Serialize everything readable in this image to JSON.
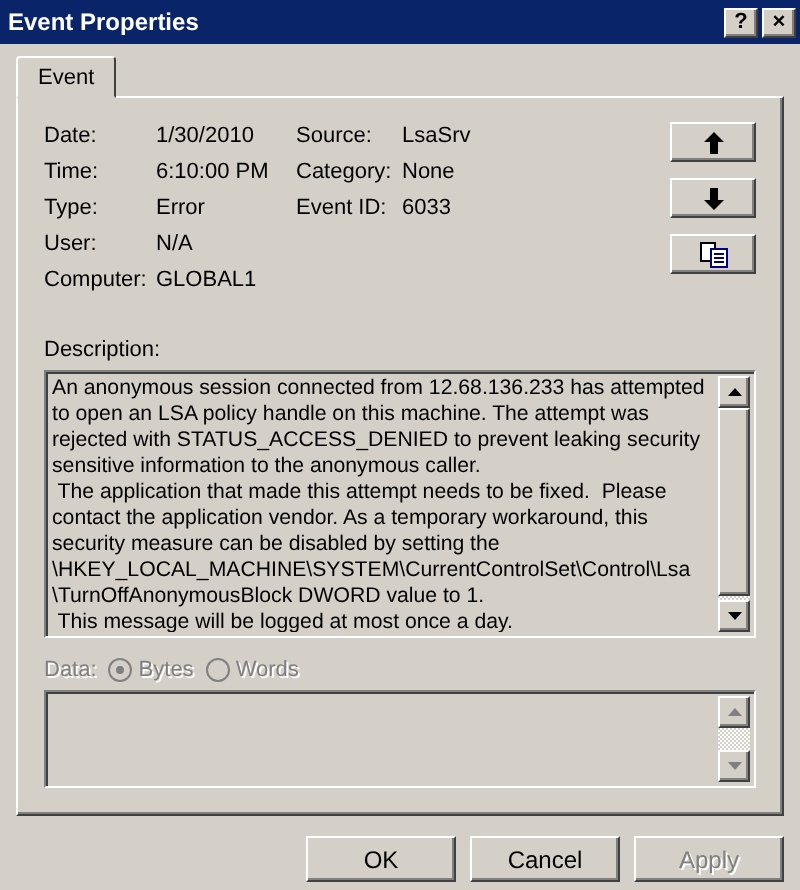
{
  "window": {
    "title": "Event Properties",
    "help": "?",
    "close": "×"
  },
  "tabs": [
    {
      "label": "Event",
      "selected": true
    }
  ],
  "fields": [
    {
      "label": "Date:",
      "value": "1/30/2010"
    },
    {
      "label": "Time:",
      "value": "6:10:00 PM"
    },
    {
      "label": "Type:",
      "value": "Error"
    },
    {
      "label": "User:",
      "value": "N/A"
    },
    {
      "label": "Computer:",
      "value": "GLOBAL1"
    }
  ],
  "fields_right": [
    {
      "label": "Source:",
      "value": "LsaSrv"
    },
    {
      "label": "Category:",
      "value": "None"
    },
    {
      "label": "Event ID:",
      "value": "6033"
    }
  ],
  "nav_buttons": [
    {
      "kind": "up"
    },
    {
      "kind": "down"
    },
    {
      "kind": "copy"
    }
  ],
  "description": {
    "label": "Description:",
    "text": "An anonymous session connected from 12.68.136.233 has attempted\nto open an LSA policy handle on this machine. The attempt was\nrejected with STATUS_ACCESS_DENIED to prevent leaking security\nsensitive information to the anonymous caller.\n The application that made this attempt needs to be fixed.  Please\ncontact the application vendor. As a temporary workaround, this\nsecurity measure can be disabled by setting the\n\\HKEY_LOCAL_MACHINE\\SYSTEM\\CurrentControlSet\\Control\\Lsa\n\\TurnOffAnonymousBlock DWORD value to 1.\n This message will be logged at most once a day."
  },
  "data": {
    "label": "Data:",
    "disabled": true,
    "options": [
      {
        "label": "Bytes",
        "selected": true
      },
      {
        "label": "Words",
        "selected": false
      }
    ]
  },
  "buttons": [
    {
      "label": "OK",
      "disabled": false
    },
    {
      "label": "Cancel",
      "disabled": false
    },
    {
      "label": "Apply",
      "disabled": true
    }
  ]
}
